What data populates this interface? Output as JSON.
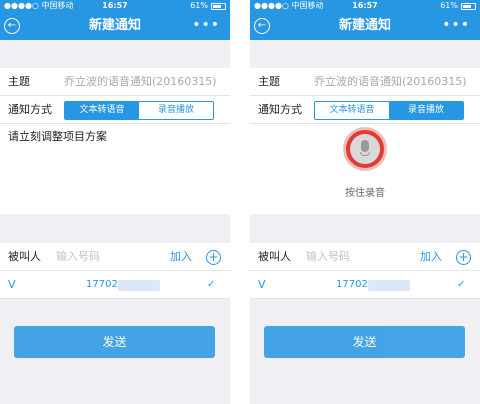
{
  "screens": [
    {
      "status": {
        "carrier": "●●●●○ 中国移动 ",
        "time": "16:57",
        "battery": "61%"
      },
      "nav": {
        "title": "新建通知",
        "more": "•••",
        "back": "←"
      },
      "topic": {
        "label": "主题",
        "value": "乔立波的语音通知(20160315)"
      },
      "method": {
        "label": "通知方式",
        "options": [
          "文本转语音",
          "录音播放"
        ],
        "selected": 0
      },
      "content_text": "请立刻调整项目方案",
      "callee": {
        "label": "被叫人",
        "placeholder": "输入号码",
        "add": "加入",
        "plus": "+"
      },
      "contact": {
        "name": "V",
        "number": "17702",
        "check": "✓"
      },
      "send": "发送"
    },
    {
      "status": {
        "carrier": "●●●●○ 中国移动 ",
        "time": "16:57",
        "battery": "61%"
      },
      "nav": {
        "title": "新建通知",
        "more": "•••",
        "back": "←"
      },
      "topic": {
        "label": "主题",
        "value": "乔立波的语音通知(20160315)"
      },
      "method": {
        "label": "通知方式",
        "options": [
          "文本转语音",
          "录音播放"
        ],
        "selected": 1
      },
      "mic_hint": "按住录音",
      "callee": {
        "label": "被叫人",
        "placeholder": "输入号码",
        "add": "加入",
        "plus": "+"
      },
      "contact": {
        "name": "V",
        "number": "17702",
        "check": "✓"
      },
      "send": "发送"
    }
  ],
  "colors": {
    "accent": "#2796e3",
    "mic": "#e13b35",
    "background": "#efeff4"
  },
  "icons": [
    "back-icon",
    "more-icon",
    "microphone-icon",
    "plus-icon",
    "check-icon",
    "battery-icon",
    "wifi-icon"
  ]
}
